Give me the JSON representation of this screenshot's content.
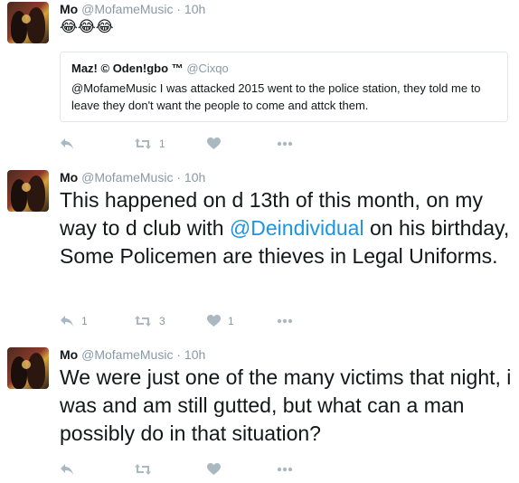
{
  "tweets": [
    {
      "name": "Mo",
      "handle": "@MofameMusic",
      "sep": "·",
      "time": "10h",
      "text": "😂😂😂",
      "quote": {
        "name": "Maz! © Oden!gbo ™",
        "handle": "@Cixqo",
        "text": "@MofameMusic I was attacked 2015 went to the police station, they told me to leave  they don't want the people to come and attck them."
      },
      "reply_count": "",
      "retweet_count": "1",
      "like_count": ""
    },
    {
      "name": "Mo",
      "handle": "@MofameMusic",
      "sep": "·",
      "time": "10h",
      "text_before": "This happened on d 13th of this month, on my way to d club with ",
      "mention": "@Deindividual",
      "text_after": " on his birthday, Some Policemen are thieves in Legal Uniforms.",
      "reply_count": "1",
      "retweet_count": "3",
      "like_count": "1"
    },
    {
      "name": "Mo",
      "handle": "@MofameMusic",
      "sep": "·",
      "time": "10h",
      "text": "We were just one of the many victims that night, i was and am still gutted, but what can a man possibly do in that situation?",
      "reply_count": "",
      "retweet_count": "",
      "like_count": ""
    }
  ],
  "icons": {
    "reply": "reply-icon",
    "retweet": "retweet-icon",
    "like": "heart-icon",
    "more": "more-icon"
  },
  "colors": {
    "link": "#1b95e0",
    "muted": "#8899a6",
    "icon": "#aab8c2",
    "border": "#e1e8ed"
  }
}
